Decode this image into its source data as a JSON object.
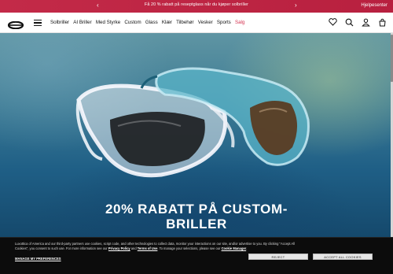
{
  "promo": {
    "text": "Få 20 % rabatt på reseptglass når du kjøper solbriller",
    "prev": "‹",
    "next": "›",
    "help": "Hjelpesenter"
  },
  "nav": {
    "links": [
      "Solbriller",
      "AI Briller",
      "Med Styrke",
      "Custom",
      "Glass",
      "Klær",
      "Tilbehør",
      "Vesker",
      "Sports",
      "Salg"
    ]
  },
  "hero": {
    "title_line1": "20% RABATT PÅ CUSTOM-",
    "title_line2": "BRILLER"
  },
  "cookie": {
    "text_line1": "Luxottica of America and our third-party partners use cookies, script code, and other technologies to collect data, monitor your interactions on our site, and/or advertise to you. By clicking \"Accept All",
    "text_line2a": "Cookies\", you consent to such use. For more information see our ",
    "privacy": "Privacy Policy",
    "and": " and ",
    "terms": "Terms of Use",
    "text_line2b": ". To manage your selections, please see our ",
    "cookie_manager": "Cookie Manager",
    "period": ".",
    "manage": "MANAGE MY PREFERENCES",
    "reject": "REJECT",
    "accept": "ACCEPT ALL COOKIES"
  },
  "colors": {
    "promo_bg": "#c32a48",
    "sale_text": "#d4324f",
    "cookie_bg": "#0c0c0c"
  }
}
